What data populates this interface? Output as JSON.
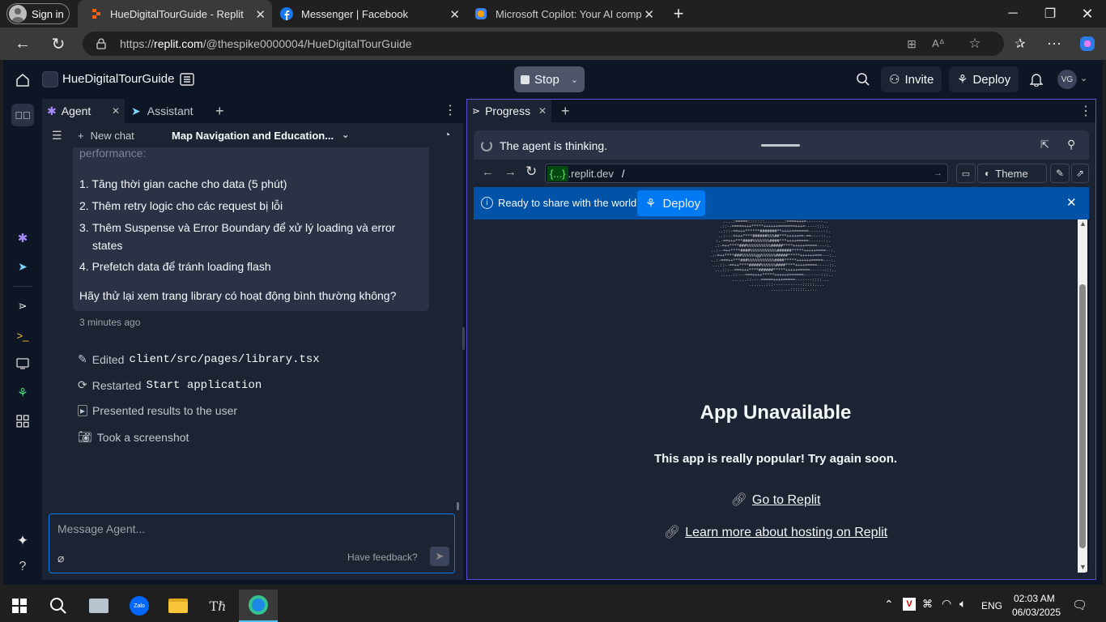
{
  "browser": {
    "sign_in": "Sign in",
    "tabs": [
      {
        "title": "HueDigitalTourGuide - Replit",
        "active": true
      },
      {
        "title": "Messenger | Facebook",
        "active": false
      },
      {
        "title": "Microsoft Copilot: Your AI compa",
        "active": false
      }
    ],
    "url_prefix": "https://",
    "url_host": "replit.com",
    "url_path": "/@thespike0000004/HueDigitalTourGuide"
  },
  "header": {
    "project_name": "HueDigitalTourGuide",
    "stop_label": "Stop",
    "invite_label": "Invite",
    "deploy_label": "Deploy",
    "avatar_initials": "VG"
  },
  "left_tabs": {
    "agent": "Agent",
    "assistant": "Assistant",
    "new_chat": "New chat",
    "chat_title": "Map Navigation and Education..."
  },
  "chat": {
    "truncated_top": "performance:",
    "items": [
      "Tăng thời gian cache cho data (5 phút)",
      "Thêm retry logic cho các request bị lỗi",
      "Thêm Suspense và Error Boundary để xử lý loading và error states",
      "Prefetch data để tránh loading flash"
    ],
    "closing": "Hãy thử lại xem trang library có hoạt động bình thường không?",
    "time": "3 minutes ago",
    "actions": {
      "edited_label": "Edited",
      "edited_file": "client/src/pages/library.tsx",
      "restarted_label": "Restarted",
      "restarted_target": "Start application",
      "presented": "Presented results to the user",
      "screenshot": "Took a screenshot"
    },
    "input_placeholder": "Message Agent...",
    "feedback": "Have feedback?"
  },
  "progress": {
    "tab_label": "Progress",
    "thinking": "The agent is thinking.",
    "url_badge": "{...}",
    "url_domain": ".replit.dev",
    "url_path": "/",
    "theme_label": "Theme",
    "share_text": "Ready to share with the world?",
    "deploy_label": "Deploy",
    "unavailable_title": "App Unavailable",
    "unavailable_sub": "This app is really popular! Try again soon.",
    "link_replit": "Go to Replit",
    "link_hosting": "Learn more about hosting on Replit"
  },
  "taskbar": {
    "lang": "ENG",
    "time": "02:03 AM",
    "date": "06/03/2025"
  },
  "colors": {
    "accent_purple": "#5c4cd6",
    "banner_blue": "#0053a6",
    "replit_bg": "#0e1525",
    "panel_bg": "#1c2333"
  }
}
